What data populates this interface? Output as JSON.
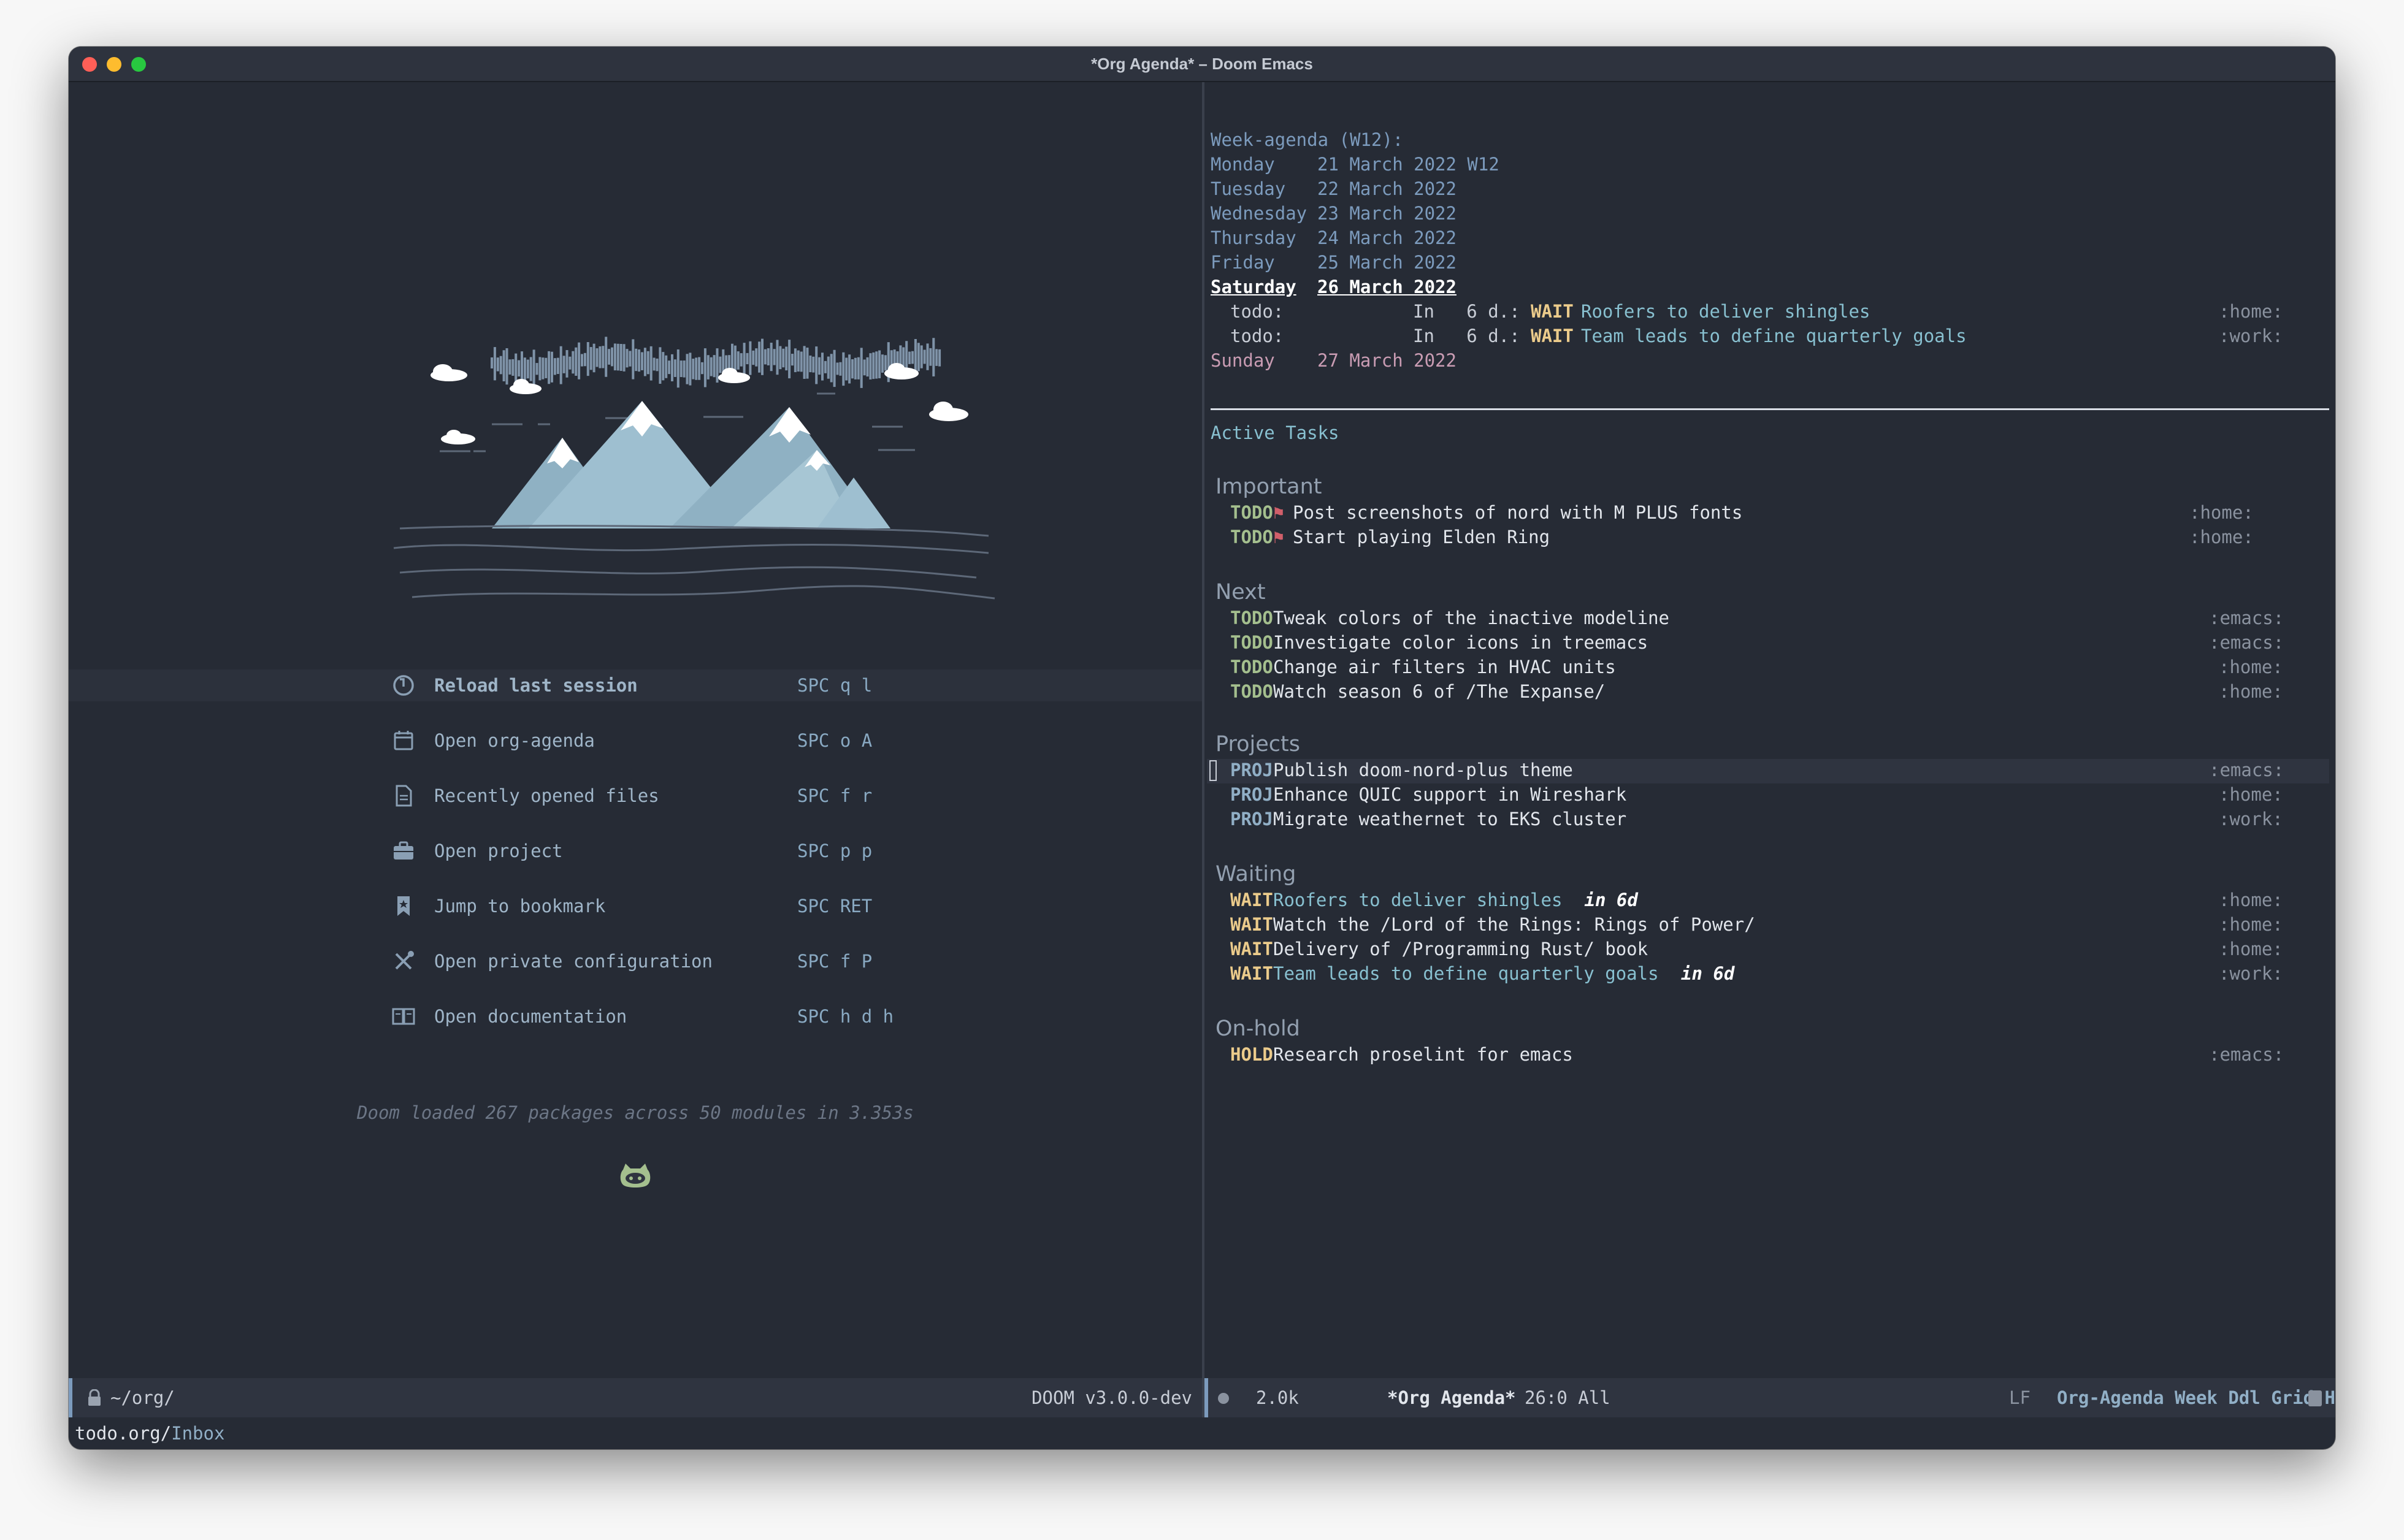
{
  "window": {
    "title": "*Org Agenda* – Doom Emacs",
    "traffic_lights": [
      "#ff5f57",
      "#febc2e",
      "#28c840"
    ]
  },
  "dashboard": {
    "menu": [
      {
        "label": "Reload last session",
        "key": "SPC q l",
        "icon": "reload-icon"
      },
      {
        "label": "Open org-agenda",
        "key": "SPC o A",
        "icon": "calendar-icon"
      },
      {
        "label": "Recently opened files",
        "key": "SPC f r",
        "icon": "file-icon"
      },
      {
        "label": "Open project",
        "key": "SPC p p",
        "icon": "briefcase-icon"
      },
      {
        "label": "Jump to bookmark",
        "key": "SPC RET",
        "icon": "bookmark-icon"
      },
      {
        "label": "Open private configuration",
        "key": "SPC f P",
        "icon": "tools-icon"
      },
      {
        "label": "Open documentation",
        "key": "SPC h d h",
        "icon": "book-icon"
      }
    ],
    "loaded_message": "Doom loaded 267 packages across 50 modules in 3.353s"
  },
  "agenda": {
    "header": "Week-agenda (W12):",
    "days": [
      {
        "name": "Monday",
        "date": "21 March 2022 W12"
      },
      {
        "name": "Tuesday",
        "date": "22 March 2022"
      },
      {
        "name": "Wednesday",
        "date": "23 March 2022"
      },
      {
        "name": "Thursday",
        "date": "24 March 2022"
      },
      {
        "name": "Friday",
        "date": "25 March 2022"
      },
      {
        "name": "Saturday",
        "date": "26 March 2022"
      },
      {
        "name": "Sunday",
        "date": "27 March 2022"
      }
    ],
    "deadlines": [
      {
        "prefix": "todo:",
        "when": "In   6 d.:",
        "keyword": "WAIT",
        "text": "Roofers to deliver shingles",
        "tag": ":home:"
      },
      {
        "prefix": "todo:",
        "when": "In   6 d.:",
        "keyword": "WAIT",
        "text": "Team leads to define quarterly goals",
        "tag": ":work:"
      }
    ],
    "active_tasks_title": "Active Tasks",
    "groups": [
      {
        "title": "Important",
        "items": [
          {
            "keyword": "TODO",
            "flag": "⚑",
            "text": "Post screenshots of nord with M PLUS fonts",
            "tag": ":home:"
          },
          {
            "keyword": "TODO",
            "flag": "⚑",
            "text": "Start playing Elden Ring",
            "tag": ":home:"
          }
        ]
      },
      {
        "title": "Next",
        "items": [
          {
            "keyword": "TODO",
            "text": "Tweak colors of the inactive modeline",
            "tag": ":emacs:"
          },
          {
            "keyword": "TODO",
            "text": "Investigate color icons in treemacs",
            "tag": ":emacs:"
          },
          {
            "keyword": "TODO",
            "text": "Change air filters in HVAC units",
            "tag": ":home:"
          },
          {
            "keyword": "TODO",
            "text": "Watch season 6 of /The Expanse/",
            "tag": ":home:"
          }
        ]
      },
      {
        "title": "Projects",
        "items": [
          {
            "keyword": "PROJ",
            "text": "Publish doom-nord-plus theme",
            "tag": ":emacs:"
          },
          {
            "keyword": "PROJ",
            "text": "Enhance QUIC support in Wireshark",
            "tag": ":home:"
          },
          {
            "keyword": "PROJ",
            "text": "Migrate weathernet to EKS cluster",
            "tag": ":work:"
          }
        ]
      },
      {
        "title": "Waiting",
        "items": [
          {
            "keyword": "WAIT",
            "text": "Roofers to deliver shingles",
            "extra": "in 6d",
            "tag": ":home:"
          },
          {
            "keyword": "WAIT",
            "text": "Watch the /Lord of the Rings: Rings of Power/",
            "tag": ":home:"
          },
          {
            "keyword": "WAIT",
            "text": "Delivery of /Programming Rust/ book",
            "tag": ":home:"
          },
          {
            "keyword": "WAIT",
            "text": "Team leads to define quarterly goals",
            "extra": "in 6d",
            "tag": ":work:"
          }
        ]
      },
      {
        "title": "On-hold",
        "items": [
          {
            "keyword": "HOLD",
            "text": "Research proselint for emacs",
            "tag": ":emacs:"
          }
        ]
      }
    ]
  },
  "modeline_left": {
    "path": "~/org/",
    "version": "DOOM v3.0.0-dev"
  },
  "modeline_right": {
    "size": "2.0k",
    "buffer": "*Org Agenda*",
    "position": "26:0 All",
    "eol": "LF",
    "mode": "Org-Agenda Week Ddl Grid Habit"
  },
  "echo": {
    "file": "todo.org/",
    "heading": "Inbox"
  },
  "colors": {
    "background": "#262b35",
    "todo": "#a4bf8e",
    "wait": "#ebcb8b",
    "proj": "#91afc6",
    "date": "#7c9bbd"
  }
}
